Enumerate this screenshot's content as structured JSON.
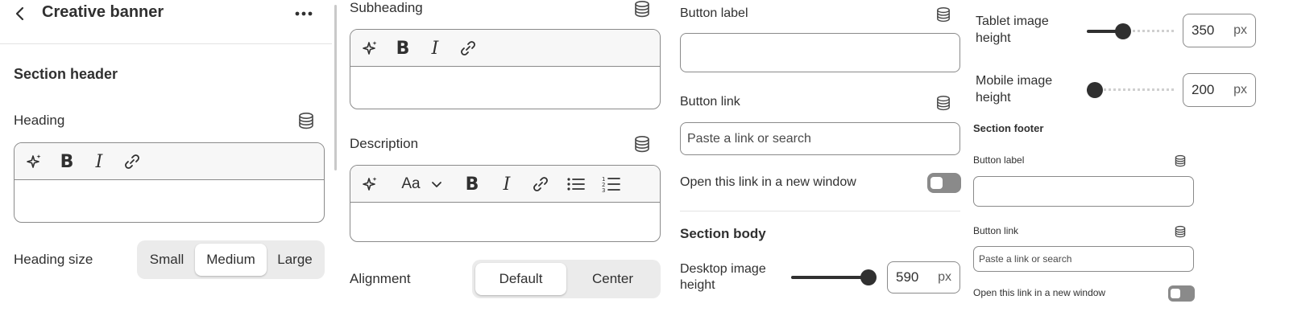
{
  "colors": {
    "text": "#303030",
    "border": "#8a8a8a",
    "toolbar_bg": "#f7f7f7",
    "segment_bg": "#ebebeb",
    "toggle_off": "#8a8a8a"
  },
  "header": {
    "title": "Creative banner"
  },
  "col1": {
    "section_title": "Section header",
    "heading_label": "Heading",
    "heading_size_label": "Heading size",
    "heading_size_options": [
      "Small",
      "Medium",
      "Large"
    ],
    "heading_size_selected": "Medium"
  },
  "col2": {
    "subheading_label": "Subheading",
    "description_label": "Description",
    "text_style_label": "Aa",
    "alignment_label": "Alignment",
    "alignment_options": [
      "Default",
      "Center"
    ],
    "alignment_selected": "Default"
  },
  "col3": {
    "button_label": "Button label",
    "button_label_value": "",
    "button_link": "Button link",
    "button_link_placeholder": "Paste a link or search",
    "new_window_label": "Open this link in a new window",
    "new_window_on": false,
    "section_body_title": "Section body",
    "desktop_label_1": "Desktop image",
    "desktop_label_2": "height",
    "desktop_value": "590",
    "desktop_fraction": 1.0,
    "unit": "px"
  },
  "col4": {
    "tablet_label_1": "Tablet image",
    "tablet_label_2": "height",
    "tablet_value": "350",
    "tablet_fraction": 0.4,
    "mobile_label_1": "Mobile image",
    "mobile_label_2": "height",
    "mobile_value": "200",
    "mobile_fraction": 0.0,
    "unit": "px",
    "footer_title": "Section footer",
    "footer_button_label": "Button label",
    "footer_button_link": "Button link",
    "footer_link_placeholder": "Paste a link or search",
    "footer_new_window_label": "Open this link in a new window",
    "footer_new_window_on": false
  }
}
